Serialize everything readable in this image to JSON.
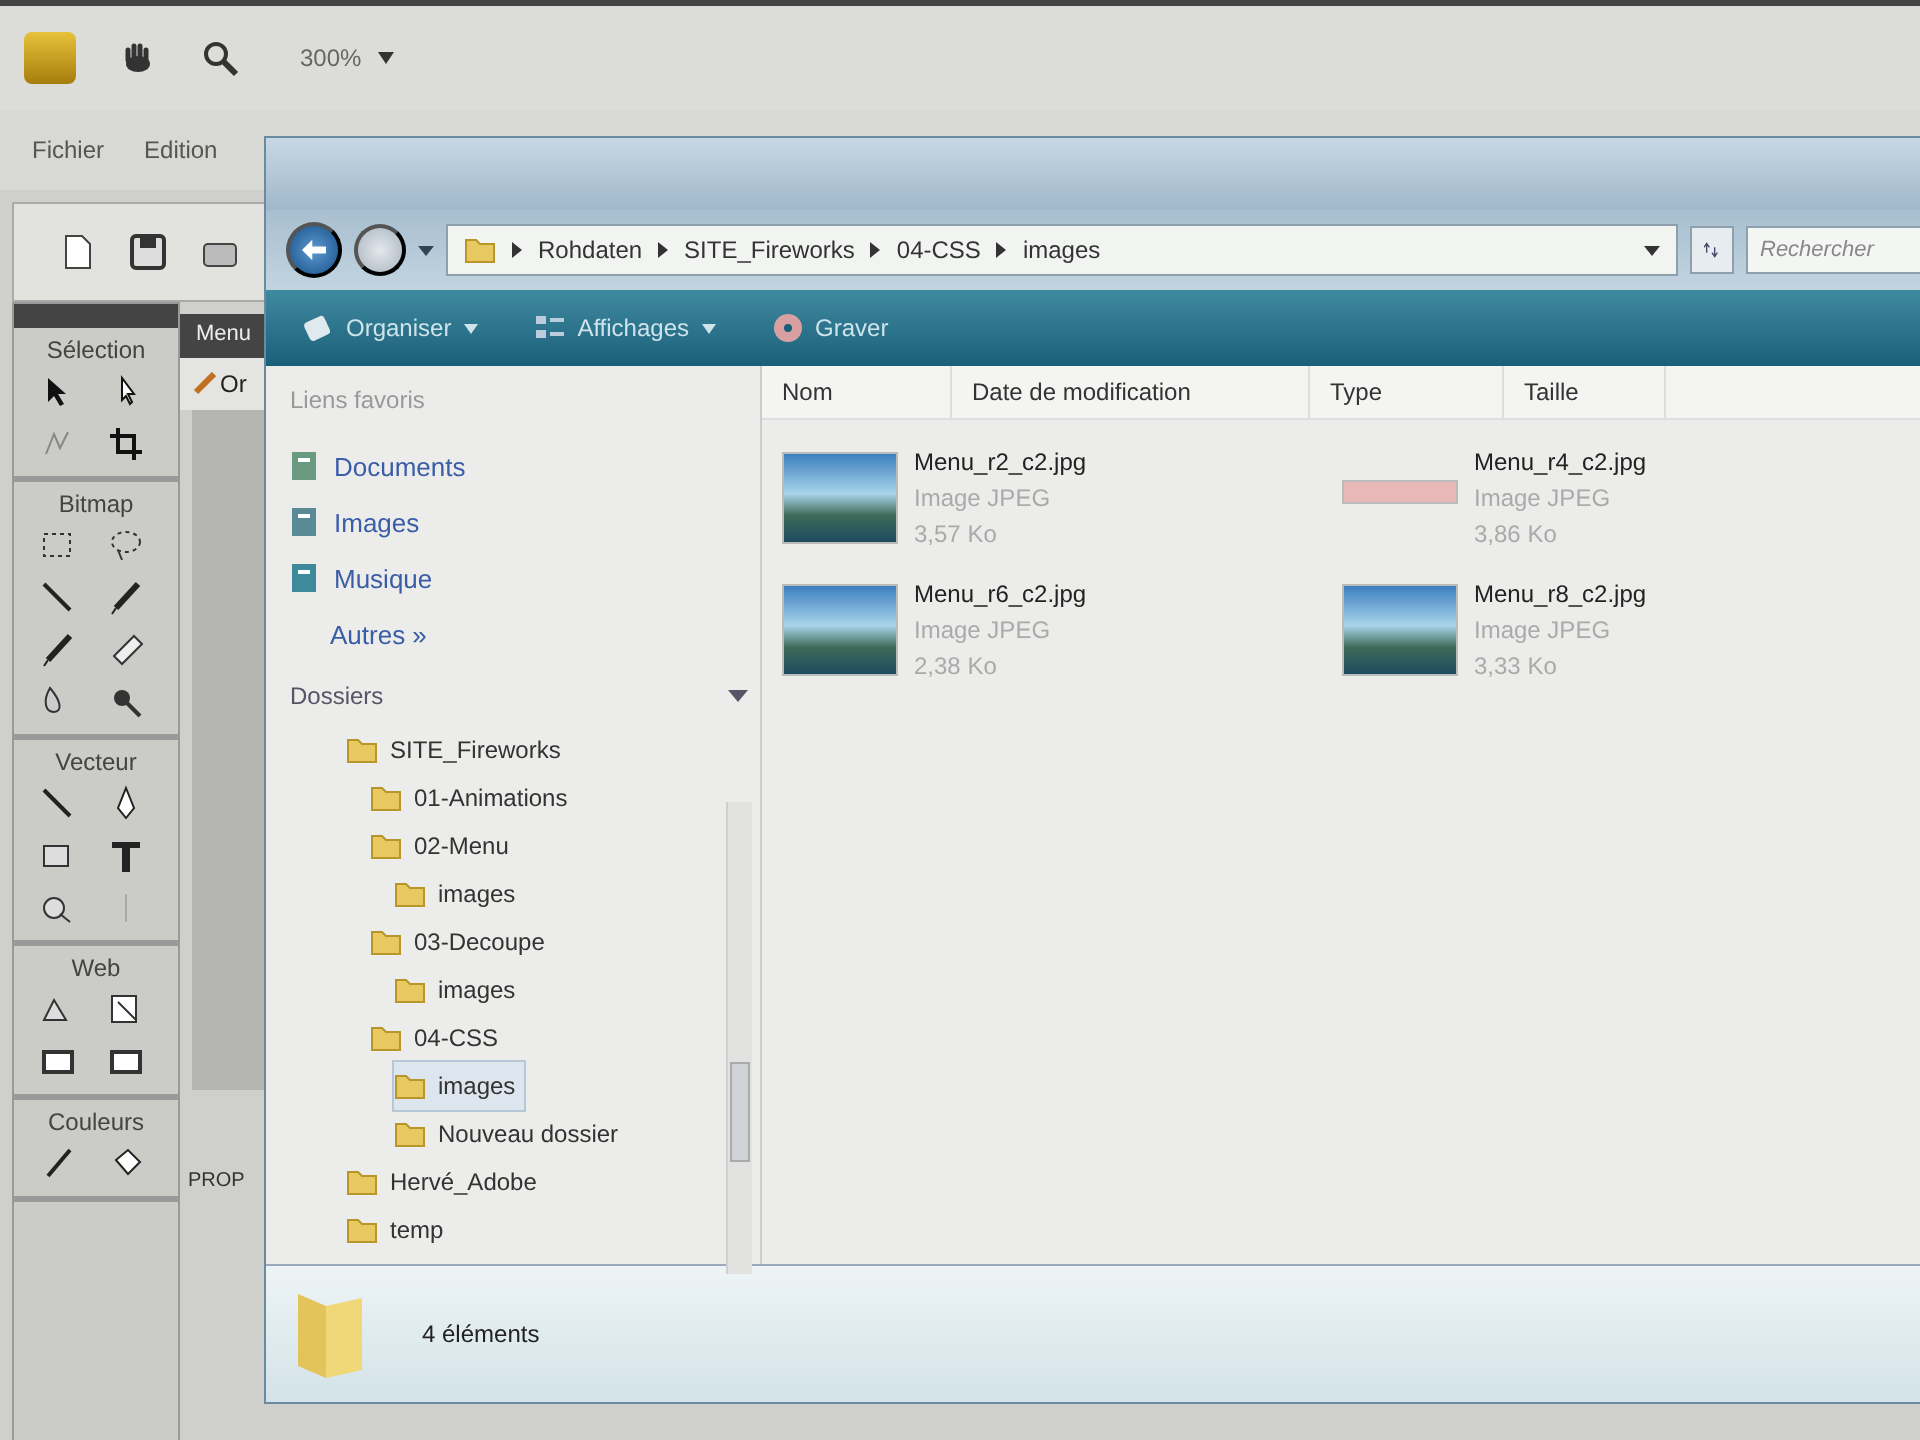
{
  "app": {
    "zoom": "300%",
    "menu": [
      "Fichier",
      "Edition"
    ],
    "document_tab": "Menu",
    "document_row": "Or",
    "panel_tab": "PROP"
  },
  "tools": [
    {
      "label": "Sélection",
      "tools": [
        {
          "kind": "pointer"
        },
        {
          "kind": "subselect"
        },
        {
          "kind": "scale"
        },
        {
          "kind": "crop"
        }
      ]
    },
    {
      "label": "Bitmap",
      "tools": [
        {
          "kind": "marquee"
        },
        {
          "kind": "lasso"
        },
        {
          "kind": "wand"
        },
        {
          "kind": "brush"
        },
        {
          "kind": "pencil"
        },
        {
          "kind": "eraser"
        },
        {
          "kind": "blur"
        },
        {
          "kind": "stamp"
        }
      ]
    },
    {
      "label": "Vecteur",
      "tools": [
        {
          "kind": "line"
        },
        {
          "kind": "pen"
        },
        {
          "kind": "rect"
        },
        {
          "kind": "text"
        },
        {
          "kind": "knife"
        },
        {
          "kind": "freeform"
        }
      ]
    },
    {
      "label": "Web",
      "tools": [
        {
          "kind": "hotspot"
        },
        {
          "kind": "slice"
        },
        {
          "kind": "hide"
        },
        {
          "kind": "show"
        }
      ]
    },
    {
      "label": "Couleurs",
      "tools": [
        {
          "kind": "eyedropper"
        },
        {
          "kind": "bucket"
        }
      ]
    }
  ],
  "explorer": {
    "breadcrumb": [
      "Rohdaten",
      "SITE_Fireworks",
      "04-CSS",
      "images"
    ],
    "search": {
      "placeholder": "Rechercher"
    },
    "toolbar": [
      {
        "label": "Organiser",
        "kind": "organize",
        "menu": true
      },
      {
        "label": "Affichages",
        "kind": "views",
        "menu": true
      },
      {
        "label": "Graver",
        "kind": "burn",
        "menu": false
      }
    ],
    "favorites_title": "Liens favoris",
    "favorites": [
      {
        "label": "Documents",
        "kind": "documents"
      },
      {
        "label": "Images",
        "kind": "pictures"
      },
      {
        "label": "Musique",
        "kind": "music"
      },
      {
        "label": "Autres »",
        "kind": "more"
      }
    ],
    "folders_title": "Dossiers",
    "tree": [
      {
        "label": "SITE_Fireworks",
        "selected": false,
        "children": [
          {
            "label": "01-Animations",
            "selected": false
          },
          {
            "label": "02-Menu",
            "selected": false,
            "children": [
              {
                "label": "images",
                "selected": false
              }
            ]
          },
          {
            "label": "03-Decoupe",
            "selected": false,
            "children": [
              {
                "label": "images",
                "selected": false
              }
            ]
          },
          {
            "label": "04-CSS",
            "selected": false,
            "children": [
              {
                "label": "images",
                "selected": true
              },
              {
                "label": "Nouveau dossier",
                "selected": false
              }
            ]
          }
        ]
      },
      {
        "label": "Hervé_Adobe",
        "selected": false
      },
      {
        "label": "temp",
        "selected": false
      }
    ],
    "columns": [
      "Nom",
      "Date de modification",
      "Type",
      "Taille"
    ],
    "files": [
      {
        "name": "Menu_r2_c2.jpg",
        "type": "Image JPEG",
        "size": "3,57 Ko",
        "kind": "photo"
      },
      {
        "name": "Menu_r4_c2.jpg",
        "type": "Image JPEG",
        "size": "3,86 Ko",
        "kind": "banner"
      },
      {
        "name": "Menu_r6_c2.jpg",
        "type": "Image JPEG",
        "size": "2,38 Ko",
        "kind": "photo"
      },
      {
        "name": "Menu_r8_c2.jpg",
        "type": "Image JPEG",
        "size": "3,33 Ko",
        "kind": "photo"
      }
    ],
    "status": "4 éléments"
  }
}
